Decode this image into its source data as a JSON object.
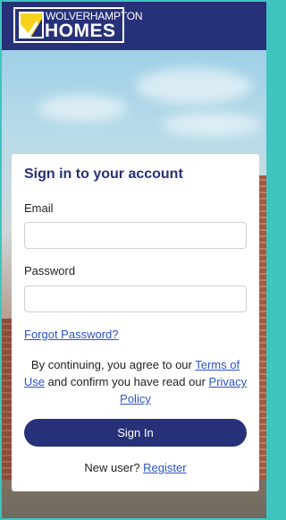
{
  "header": {
    "logo_line1": "WOLVERHAMPTON",
    "logo_line2": "HOMES",
    "brand_color": "#27317a",
    "logo_accent": "#f5d31c"
  },
  "login": {
    "title": "Sign in to your account",
    "email_label": "Email",
    "email_value": "",
    "password_label": "Password",
    "password_value": "",
    "forgot_link": "Forgot Password?",
    "terms_prefix": "By continuing, you agree to our ",
    "terms_link": "Terms of Use",
    "terms_middle": " and confirm you have read our ",
    "privacy_link": "Privacy Policy",
    "signin_button": "Sign In",
    "new_user_text": "New user? ",
    "register_link": "Register"
  }
}
